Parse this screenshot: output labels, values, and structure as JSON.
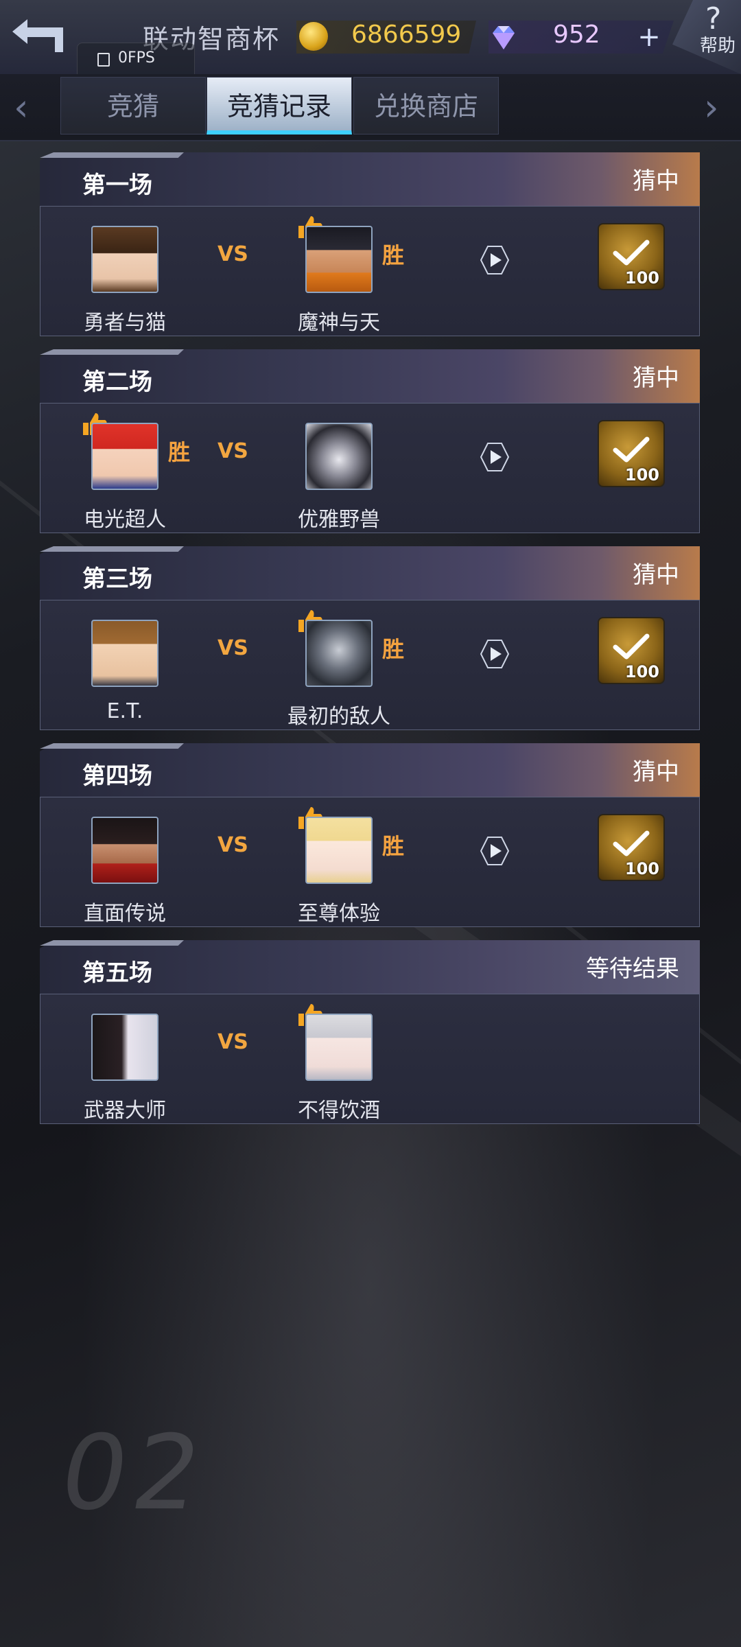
{
  "header": {
    "title": "联动智商杯",
    "coins": "6866599",
    "gems": "952",
    "plus": "+",
    "help_symbol": "?",
    "help_label": "帮助",
    "fps": "0FPS"
  },
  "tabs": [
    {
      "label": "竞猜",
      "active": false
    },
    {
      "label": "竞猜记录",
      "active": true
    },
    {
      "label": "兑换商店",
      "active": false
    }
  ],
  "nav": {
    "left": "‹",
    "right": "›"
  },
  "vs_label": "VS",
  "win_label": "胜",
  "matches": [
    {
      "round": "第一场",
      "result": "猜中",
      "left": "勇者与猫",
      "right": "魔神与天",
      "winner": "right",
      "bet": "100"
    },
    {
      "round": "第二场",
      "result": "猜中",
      "left": "电光超人",
      "right": "优雅野兽",
      "winner": "left",
      "bet": "100"
    },
    {
      "round": "第三场",
      "result": "猜中",
      "left": "E.T.",
      "right": "最初的敌人",
      "winner": "right",
      "bet": "100"
    },
    {
      "round": "第四场",
      "result": "猜中",
      "left": "直面传说",
      "right": "至尊体验",
      "winner": "right",
      "bet": "100"
    },
    {
      "round": "第五场",
      "result": "等待结果",
      "left": "武器大师",
      "right": "不得饮酒",
      "winner": "",
      "bet": ""
    }
  ],
  "background_text": "02",
  "colors": {
    "accent_win": "#f5a340",
    "tab_active_underline": "#3ed0ff",
    "coin": "#f2c94c",
    "gem": "#e8c8ff"
  }
}
